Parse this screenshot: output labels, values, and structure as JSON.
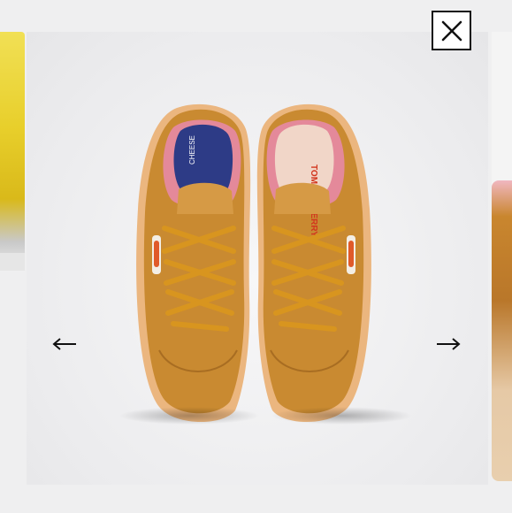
{
  "viewer": {
    "title": "",
    "close_label": "Close",
    "previous_label": "Previous image",
    "next_label": "Next image"
  },
  "product_image": {
    "shoe_colors": {
      "suede": "#c88a30",
      "lining": "#e58b97",
      "sole": "#e8b27f",
      "tongue_inner": "#2c3c86",
      "laces": "#d59421"
    },
    "tongue_text_left": "CHEESE",
    "tongue_text_right": "TOM AND JERRY"
  },
  "icons": {
    "close": "close-icon",
    "previous": "arrow-left-icon",
    "next": "arrow-right-icon"
  }
}
